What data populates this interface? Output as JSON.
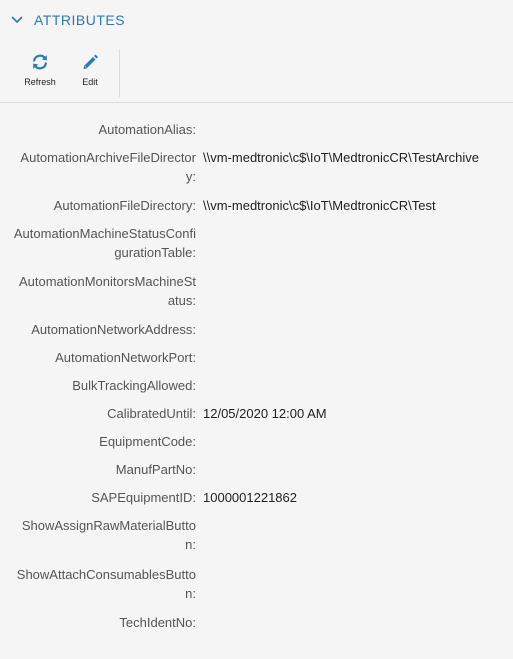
{
  "section": {
    "title": "ATTRIBUTES",
    "collapse_icon": "chevron-down-icon",
    "accent_color": "#2a7ab8"
  },
  "toolbar": {
    "refresh": {
      "label": "Refresh",
      "icon": "refresh-icon"
    },
    "edit": {
      "label": "Edit",
      "icon": "pencil-icon"
    }
  },
  "attributes": [
    {
      "label": "AutomationAlias:",
      "value": ""
    },
    {
      "label": "AutomationArchiveFileDirectory:",
      "value": "\\\\vm-medtronic\\c$\\IoT\\MedtronicCR\\TestArchive"
    },
    {
      "label": "AutomationFileDirectory:",
      "value": "\\\\vm-medtronic\\c$\\IoT\\MedtronicCR\\Test"
    },
    {
      "label": "AutomationMachineStatusConfigurationTable:",
      "value": ""
    },
    {
      "label": "AutomationMonitorsMachineStatus:",
      "value": ""
    },
    {
      "label": "AutomationNetworkAddress:",
      "value": ""
    },
    {
      "label": "AutomationNetworkPort:",
      "value": ""
    },
    {
      "label": "BulkTrackingAllowed:",
      "value": ""
    },
    {
      "label": "CalibratedUntil:",
      "value": "12/05/2020 12:00 AM"
    },
    {
      "label": "EquipmentCode:",
      "value": ""
    },
    {
      "label": "ManufPartNo:",
      "value": ""
    },
    {
      "label": "SAPEquipmentID:",
      "value": "1000001221862"
    },
    {
      "label": "ShowAssignRawMaterialButton:",
      "value": ""
    },
    {
      "label": "ShowAttachConsumablesButton:",
      "value": ""
    },
    {
      "label": "TechIdentNo:",
      "value": ""
    }
  ]
}
